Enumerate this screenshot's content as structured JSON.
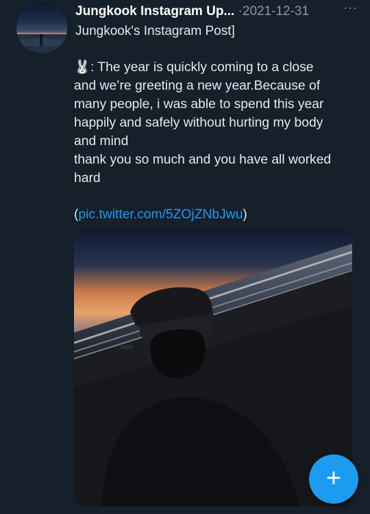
{
  "tweet": {
    "display_name": "Jungkook Instagram Up...",
    "separator": "·",
    "date": "2021-12-31",
    "more_icon": "more-horizontal-icon",
    "subtitle": "Jungkook's Instagram Post]",
    "emoji": "🐰",
    "body_lines": [
      ": The year is quickly coming to a close",
      "and we’re greeting a new year.Because of",
      "many people, i was able to spend this year",
      "happily and safely without hurting my body",
      "and mind",
      "thank you so much and you have all worked",
      "hard"
    ],
    "link_open": "(",
    "link_text": "pic.twitter.com/5ZOjZNbJwu",
    "link_close": ")"
  },
  "fab": {
    "icon": "plus-icon",
    "symbol": "+",
    "color": "#1d9bf0"
  },
  "colors": {
    "background": "#15202b",
    "secondary_text": "#8b98a5",
    "link": "#1d9bf0"
  }
}
